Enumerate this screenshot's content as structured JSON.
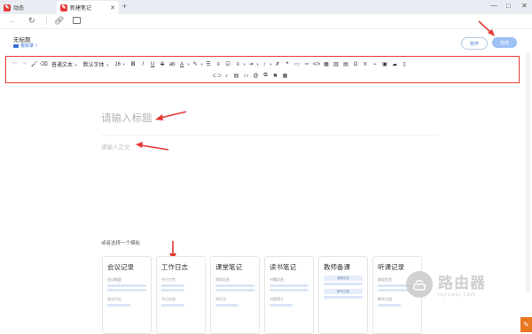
{
  "tabs": [
    {
      "label": "动态",
      "active": false
    },
    {
      "label": "新建笔记",
      "active": true
    }
  ],
  "note": {
    "title": "无标题",
    "folder": "根目录"
  },
  "header_buttons": {
    "collab": "协作",
    "save": "完成"
  },
  "toolbar": {
    "paragraph_style": "普通文本",
    "font_family": "默认字体",
    "font_size": "16",
    "bold": "B",
    "italic": "I",
    "underline": "U",
    "strike": "S",
    "text_color": "A",
    "quote": "❝",
    "omega": "Ω",
    "pi": "π"
  },
  "editor": {
    "title_placeholder": "请输入标题",
    "body_placeholder": "请输入正文"
  },
  "templates": {
    "heading": "或者选择一个模板",
    "cards": [
      {
        "name": "会议记录",
        "labels": [
          "会议概要",
          "会议讨论"
        ]
      },
      {
        "name": "工作日志",
        "labels": [
          "今日工作",
          "今日总结"
        ]
      },
      {
        "name": "课堂笔记",
        "labels": [
          "课程信息",
          "知识点"
        ]
      },
      {
        "name": "读书笔记",
        "labels": [
          "书籍信息",
          "内容简介"
        ]
      },
      {
        "name": "教师备课",
        "labels": [
          "课程信息",
          "教学过程"
        ]
      },
      {
        "name": "听课记录",
        "labels": [
          "课程信息",
          "教学过程"
        ]
      }
    ]
  },
  "watermark": {
    "text": "路由器",
    "sub": "luyouqi.com"
  },
  "colors": {
    "accent": "#3a6fd8",
    "annotation_red": "#e53935",
    "save_button": "#9dc0f5"
  }
}
